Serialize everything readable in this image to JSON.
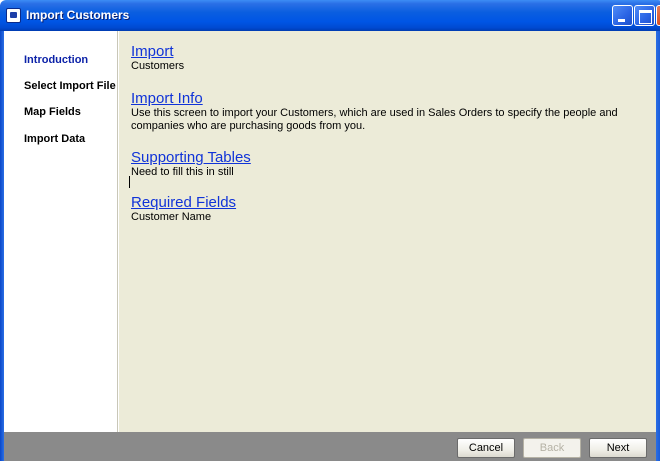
{
  "window": {
    "title": "Import Customers"
  },
  "sidebar": {
    "items": [
      {
        "label": "Introduction",
        "active": true
      },
      {
        "label": "Select Import File",
        "active": false
      },
      {
        "label": "Map Fields",
        "active": false
      },
      {
        "label": "Import Data",
        "active": false
      }
    ]
  },
  "main": {
    "sections": [
      {
        "heading": "Import",
        "body": [
          "Customers"
        ]
      },
      {
        "heading": "Import Info",
        "body": [
          "Use this screen to import your Customers, which are used in Sales Orders to specify the people and",
          "companies who are purchasing goods from you."
        ]
      },
      {
        "heading": "Supporting Tables",
        "body": [
          "Need to fill this in still"
        ]
      },
      {
        "heading": "Required Fields",
        "body": [
          "Customer Name"
        ]
      }
    ]
  },
  "buttons": {
    "cancel": "Cancel",
    "back": "Back",
    "next": "Next"
  },
  "colors": {
    "title_bar": "#0055e5",
    "content_bg": "#ecebd8",
    "link": "#1033d8",
    "active_step": "#0c22a8",
    "button_bar": "#8a8a8a"
  }
}
